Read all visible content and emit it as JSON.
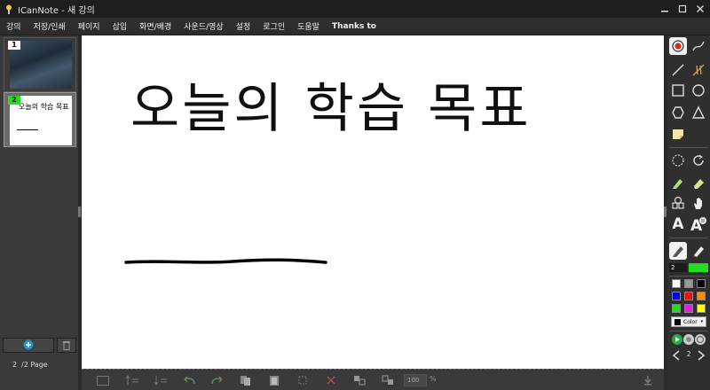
{
  "window": {
    "title": "ICanNote - 새 강의"
  },
  "menu": {
    "items": [
      "강의",
      "저장/인쇄",
      "페이지",
      "삽입",
      "화면/배경",
      "사운드/영상",
      "설정",
      "로그인",
      "도움말",
      "Thanks to"
    ]
  },
  "pages": {
    "thumbs": [
      {
        "number": "1"
      },
      {
        "number": "2",
        "preview_text": "오늘의 학습 목표"
      }
    ],
    "current": "2",
    "total_label": "/2 Page"
  },
  "canvas": {
    "heading": "오늘의 학습 목표"
  },
  "bottom_toolbar": {
    "zoom_value": "100",
    "zoom_unit": "%"
  },
  "right_panel": {
    "pen_size": "2",
    "color_button_label": "Color",
    "slide_number": "2",
    "active_pen_color": "#22dd22",
    "palette": [
      "#ffffff",
      "#9a9a9a",
      "#000000",
      "#0000ee",
      "#ee1111",
      "#ff8c00",
      "#22dd22",
      "#dd22dd",
      "#ffff00"
    ]
  }
}
